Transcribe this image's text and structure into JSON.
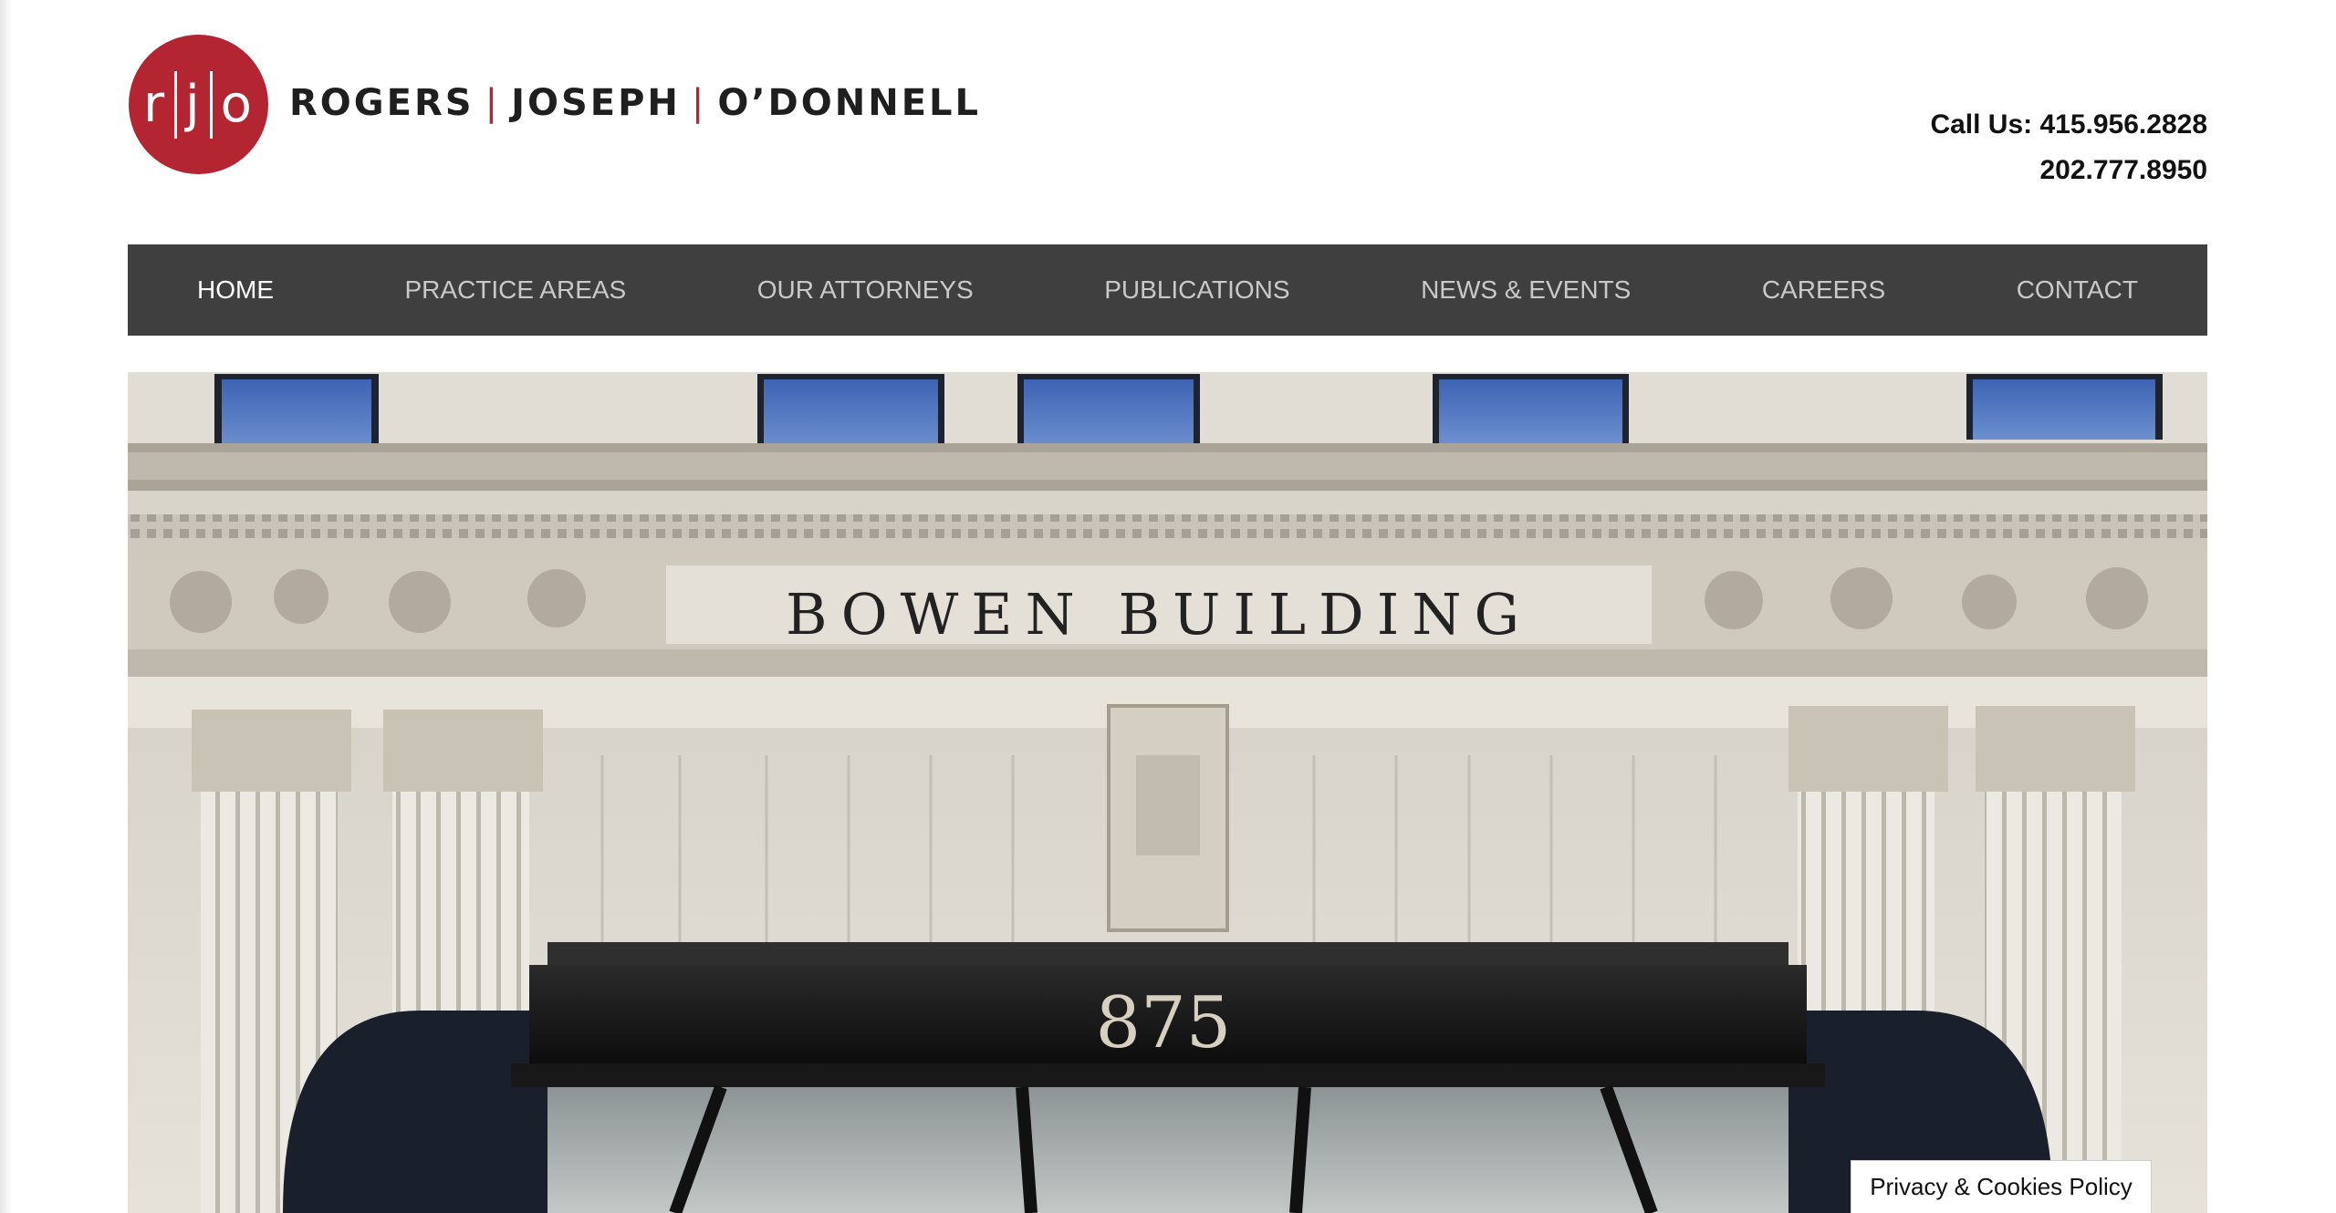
{
  "brand": {
    "monogram": [
      "r",
      "j",
      "o"
    ],
    "names": [
      "ROGERS",
      "JOSEPH",
      "O’DONNELL"
    ],
    "separator": "|",
    "color": "#b32631"
  },
  "contact": {
    "line1": "Call Us: 415.956.2828",
    "line2": "202.777.8950"
  },
  "nav": {
    "items": [
      {
        "label": "HOME",
        "active": true
      },
      {
        "label": "PRACTICE AREAS"
      },
      {
        "label": "OUR ATTORNEYS"
      },
      {
        "label": "PUBLICATIONS"
      },
      {
        "label": "NEWS & EVENTS"
      },
      {
        "label": "CAREERS"
      },
      {
        "label": "CONTACT"
      }
    ],
    "background": "#3f3f3f"
  },
  "hero": {
    "building_name": "BOWEN BUILDING",
    "street_number": "875"
  },
  "cookie_link": "Privacy & Cookies Policy"
}
